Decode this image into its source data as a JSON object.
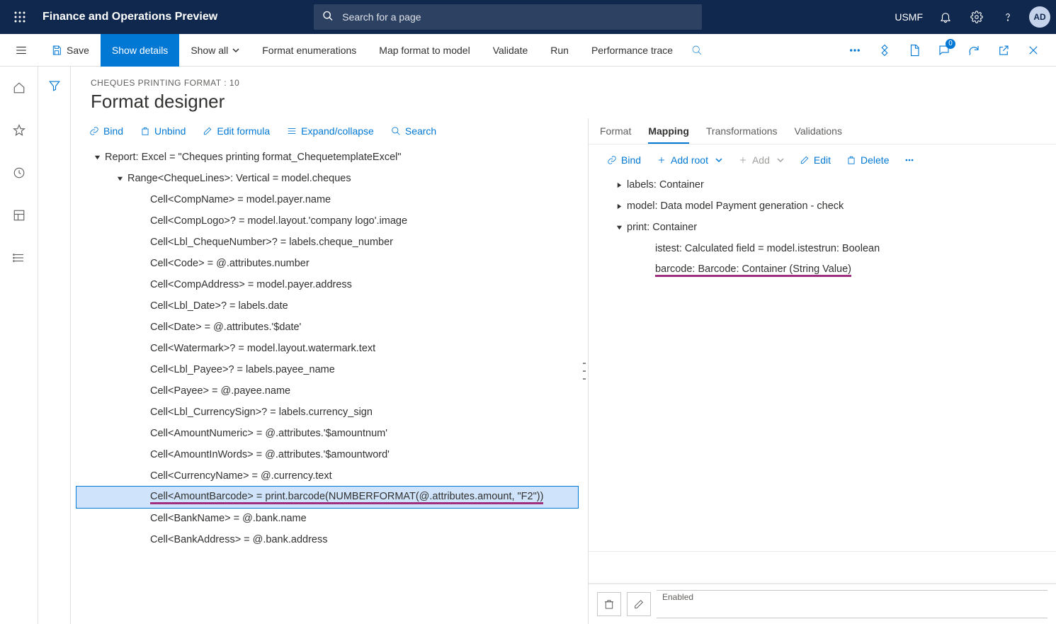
{
  "topbar": {
    "app_title": "Finance and Operations Preview",
    "search_placeholder": "Search for a page",
    "company": "USMF",
    "avatar_initials": "AD"
  },
  "toolbar": {
    "save": "Save",
    "show_details": "Show details",
    "show_all": "Show all",
    "format_enum": "Format enumerations",
    "map_format": "Map format to model",
    "validate": "Validate",
    "run": "Run",
    "perf_trace": "Performance trace",
    "badge_count": "0"
  },
  "page": {
    "breadcrumb": "CHEQUES PRINTING FORMAT : 10",
    "title": "Format designer"
  },
  "left_actions": {
    "bind": "Bind",
    "unbind": "Unbind",
    "edit_formula": "Edit formula",
    "expand": "Expand/collapse",
    "search": "Search"
  },
  "format_tree": {
    "root": "Report: Excel = \"Cheques printing format_ChequetemplateExcel\"",
    "range": "Range<ChequeLines>: Vertical = model.cheques",
    "cells": [
      "Cell<CompName> = model.payer.name",
      "Cell<CompLogo>? = model.layout.'company logo'.image",
      "Cell<Lbl_ChequeNumber>? = labels.cheque_number",
      "Cell<Code> = @.attributes.number",
      "Cell<CompAddress> = model.payer.address",
      "Cell<Lbl_Date>? = labels.date",
      "Cell<Date> = @.attributes.'$date'",
      "Cell<Watermark>? = model.layout.watermark.text",
      "Cell<Lbl_Payee>? = labels.payee_name",
      "Cell<Payee> = @.payee.name",
      "Cell<Lbl_CurrencySign>? = labels.currency_sign",
      "Cell<AmountNumeric> = @.attributes.'$amountnum'",
      "Cell<AmountInWords> = @.attributes.'$amountword'",
      "Cell<CurrencyName> = @.currency.text",
      "Cell<AmountBarcode> = print.barcode(NUMBERFORMAT(@.attributes.amount, \"F2\"))",
      "Cell<BankName> = @.bank.name",
      "Cell<BankAddress> = @.bank.address"
    ]
  },
  "right_tabs": {
    "format": "Format",
    "mapping": "Mapping",
    "transformations": "Transformations",
    "validations": "Validations"
  },
  "right_actions": {
    "bind": "Bind",
    "add_root": "Add root",
    "add": "Add",
    "edit": "Edit",
    "delete": "Delete"
  },
  "mapping_tree": {
    "labels": "labels: Container",
    "model": "model: Data model Payment generation - check",
    "print": "print: Container",
    "istest": "istest: Calculated field = model.istestrun: Boolean",
    "barcode": "barcode: Barcode: Container (String Value)"
  },
  "bottom": {
    "enabled_label": "Enabled"
  }
}
